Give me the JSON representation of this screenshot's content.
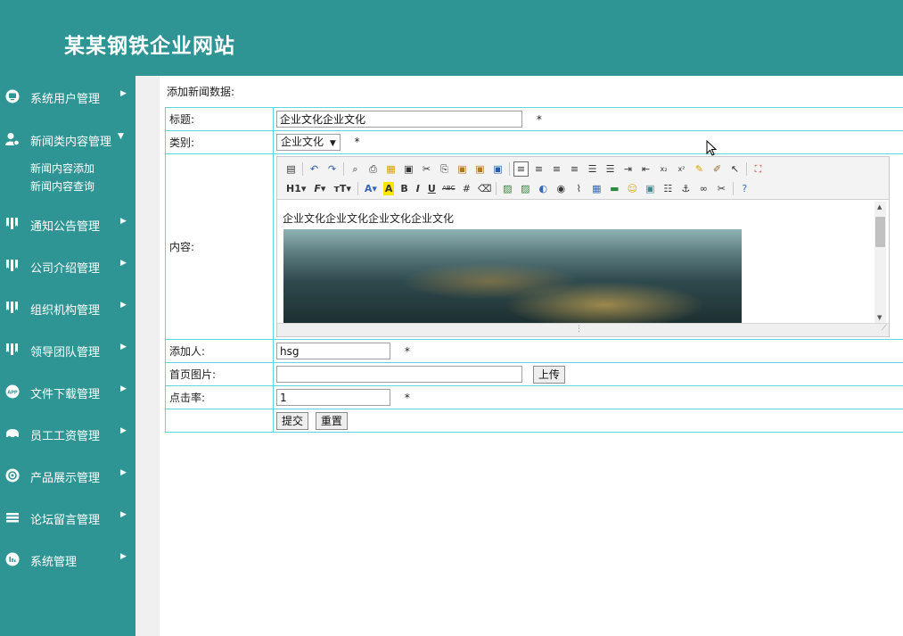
{
  "header": {
    "title": "某某钢铁企业网站"
  },
  "sidebar": {
    "items": [
      {
        "label": "系统用户管理",
        "icon": "monitor-icon",
        "arrow": "▶"
      },
      {
        "label": "新闻类内容管理",
        "icon": "user-gear-icon",
        "arrow": "▼",
        "sub": [
          "新闻内容添加",
          "新闻内容查询"
        ]
      },
      {
        "label": "通知公告管理",
        "icon": "bookmark-icon",
        "arrow": "▶"
      },
      {
        "label": "公司介绍管理",
        "icon": "bookmark-icon",
        "arrow": "▶"
      },
      {
        "label": "组织机构管理",
        "icon": "bookmark-icon",
        "arrow": "▶"
      },
      {
        "label": "领导团队管理",
        "icon": "bookmark-icon",
        "arrow": "▶"
      },
      {
        "label": "文件下载管理",
        "icon": "app-icon",
        "arrow": "▶"
      },
      {
        "label": "员工工资管理",
        "icon": "car-icon",
        "arrow": "▶"
      },
      {
        "label": "产品展示管理",
        "icon": "settings-icon",
        "arrow": "▶"
      },
      {
        "label": "论坛留言管理",
        "icon": "layers-icon",
        "arrow": "▶"
      },
      {
        "label": "系统管理",
        "icon": "chart-icon",
        "arrow": "▶"
      }
    ]
  },
  "main": {
    "page_label": "添加新闻数据:",
    "form": {
      "title_label": "标题:",
      "title_value": "企业文化企业文化",
      "category_label": "类别:",
      "category_value": "企业文化",
      "content_label": "内容:",
      "content_text": "企业文化企业文化企业文化企业文化",
      "author_label": "添加人:",
      "author_value": "hsg",
      "image_label": "首页图片:",
      "image_value": "",
      "upload_button": "上传",
      "clicks_label": "点击率:",
      "clicks_value": "1",
      "required_mark": "*",
      "submit_button": "提交",
      "reset_button": "重置"
    }
  }
}
